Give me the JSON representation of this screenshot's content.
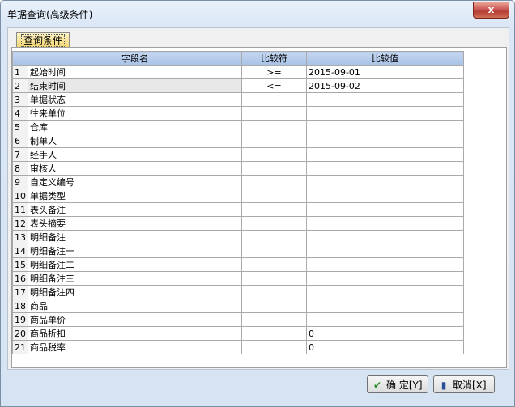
{
  "window": {
    "title": "单据查询(高级条件)",
    "close_glyph": "x"
  },
  "tab": {
    "label": "查询条件"
  },
  "grid": {
    "headers": {
      "field": "字段名",
      "operator": "比较符",
      "value": "比较值"
    },
    "rows": [
      {
        "num": "1",
        "field": "起始时间",
        "op": ">=",
        "value": "2015-09-01"
      },
      {
        "num": "2",
        "field": "结束时间",
        "op": "<=",
        "value": "2015-09-02"
      },
      {
        "num": "3",
        "field": "单据状态",
        "op": "",
        "value": ""
      },
      {
        "num": "4",
        "field": "往来单位",
        "op": "",
        "value": ""
      },
      {
        "num": "5",
        "field": "仓库",
        "op": "",
        "value": ""
      },
      {
        "num": "6",
        "field": "制单人",
        "op": "",
        "value": ""
      },
      {
        "num": "7",
        "field": "经手人",
        "op": "",
        "value": ""
      },
      {
        "num": "8",
        "field": "审核人",
        "op": "",
        "value": ""
      },
      {
        "num": "9",
        "field": "自定义编号",
        "op": "",
        "value": ""
      },
      {
        "num": "10",
        "field": "单据类型",
        "op": "",
        "value": ""
      },
      {
        "num": "11",
        "field": "表头备注",
        "op": "",
        "value": ""
      },
      {
        "num": "12",
        "field": "表头摘要",
        "op": "",
        "value": ""
      },
      {
        "num": "13",
        "field": "明细备注",
        "op": "",
        "value": ""
      },
      {
        "num": "14",
        "field": "明细备注一",
        "op": "",
        "value": ""
      },
      {
        "num": "15",
        "field": "明细备注二",
        "op": "",
        "value": ""
      },
      {
        "num": "16",
        "field": "明细备注三",
        "op": "",
        "value": ""
      },
      {
        "num": "17",
        "field": "明细备注四",
        "op": "",
        "value": ""
      },
      {
        "num": "18",
        "field": "商品",
        "op": "",
        "value": ""
      },
      {
        "num": "19",
        "field": "商品单价",
        "op": "",
        "value": ""
      },
      {
        "num": "20",
        "field": "商品折扣",
        "op": "",
        "value": "0"
      },
      {
        "num": "21",
        "field": "商品税率",
        "op": "",
        "value": "0"
      }
    ]
  },
  "buttons": {
    "ok": "确 定[Y]",
    "cancel": "取消[X]"
  }
}
